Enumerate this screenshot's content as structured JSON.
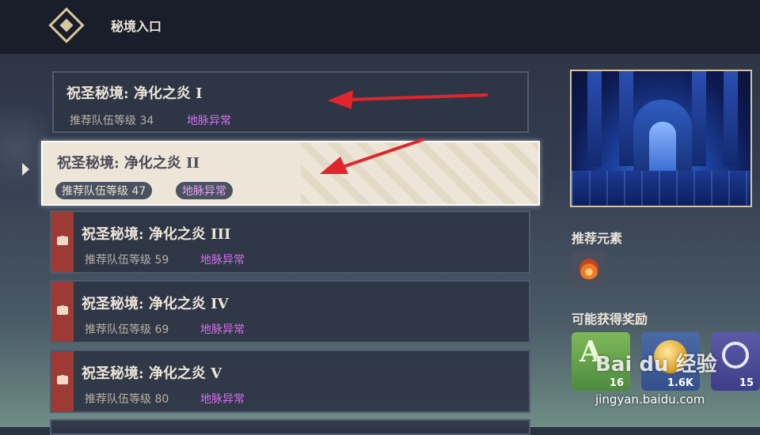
{
  "header": {
    "title": "秘境入口"
  },
  "domains": [
    {
      "name": "祝圣秘境: 净化之炎 I",
      "level": "推荐队伍等级 34",
      "tag": "地脉异常"
    },
    {
      "name": "祝圣秘境: 净化之炎 II",
      "level": "推荐队伍等级 47",
      "tag": "地脉异常"
    },
    {
      "name": "祝圣秘境: 净化之炎 III",
      "level": "推荐队伍等级 59",
      "tag": "地脉异常"
    },
    {
      "name": "祝圣秘境: 净化之炎 IV",
      "level": "推荐队伍等级 69",
      "tag": "地脉异常"
    },
    {
      "name": "祝圣秘境: 净化之炎 V",
      "level": "推荐队伍等级 80",
      "tag": "地脉异常"
    }
  ],
  "selected_index": 1,
  "side": {
    "recommended_elements_label": "推荐元素",
    "element_icon": "pyro-icon",
    "rewards_label": "可能获得奖励",
    "rewards": [
      {
        "icon": "exp-book-icon",
        "letter": "A",
        "count": "16"
      },
      {
        "icon": "mora-coin-icon",
        "count": "1.6K"
      },
      {
        "icon": "companionship-exp-icon",
        "count": "15"
      }
    ]
  },
  "watermark": {
    "brand": "Bai du 经验",
    "url": "jingyan.baidu.com"
  },
  "colors": {
    "accent_tag": "#d271ec",
    "lock_strip": "#9c3a33",
    "annotation_arrow": "#e0262b"
  }
}
